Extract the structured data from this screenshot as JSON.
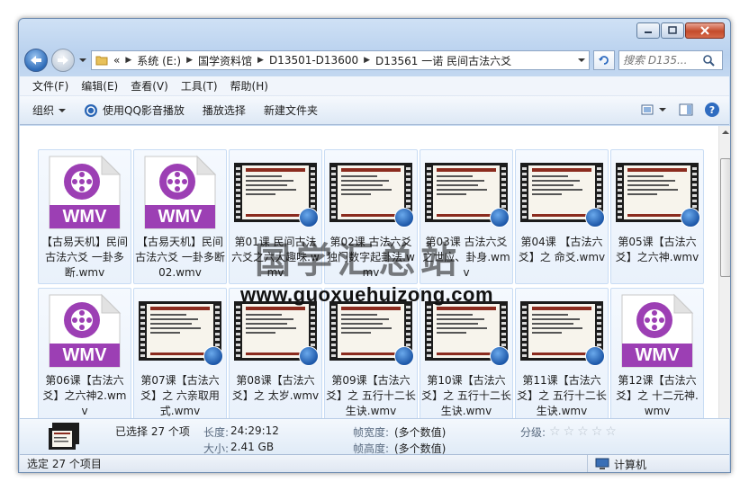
{
  "address_bar": {
    "overflow": "«",
    "crumbs": [
      "系统 (E:)",
      "国学资料馆",
      "D13501-D13600",
      "D13561 一诺 民间古法六爻"
    ]
  },
  "search": {
    "placeholder": "搜索 D135..."
  },
  "menu": [
    "文件(F)",
    "编辑(E)",
    "查看(V)",
    "工具(T)",
    "帮助(H)"
  ],
  "toolbar": {
    "organize": "组织",
    "play_qq": "使用QQ影音播放",
    "play_selection": "播放选择",
    "new_folder": "新建文件夹"
  },
  "files": [
    {
      "name": "【古易天机】民间古法六爻 一卦多断.wmv",
      "kind": "wmv"
    },
    {
      "name": "【古易天机】民间古法六爻 一卦多断02.wmv",
      "kind": "wmv"
    },
    {
      "name": "第01课 民间古法六爻之六大趣味.wmv",
      "kind": "video"
    },
    {
      "name": "第02课 古法六爻独门数字起卦法.wmv",
      "kind": "video"
    },
    {
      "name": "第03课 古法六爻之世应、卦身.wmv",
      "kind": "video"
    },
    {
      "name": "第04课 【古法六爻】之 命爻.wmv",
      "kind": "video"
    },
    {
      "name": "第05课【古法六爻】之六神.wmv",
      "kind": "video"
    },
    {
      "name": "第06课【古法六爻】之六神2.wmv",
      "kind": "wmv"
    },
    {
      "name": "第07课【古法六爻】之 六亲取用式.wmv",
      "kind": "video"
    },
    {
      "name": "第08课【古法六爻】之 太岁.wmv",
      "kind": "video"
    },
    {
      "name": "第09课【古法六爻】之 五行十二长生诀.wmv",
      "kind": "video"
    },
    {
      "name": "第10课【古法六爻】之 五行十二长生诀.wmv",
      "kind": "video"
    },
    {
      "name": "第11课【古法六爻】之 五行十二长生诀.wmv",
      "kind": "video"
    },
    {
      "name": "第12课【古法六爻】之 十二元神.wmv",
      "kind": "wmv"
    }
  ],
  "wmv_label": "WMV",
  "watermark": {
    "cn": "国学汇总站",
    "url": "www.guoxuehuizong.com"
  },
  "details": {
    "selected": "已选择 27 个项",
    "length_label": "长度:",
    "length_value": "24:29:12",
    "size_label": "大小:",
    "size_value": "2.41 GB",
    "frame_width_label": "帧宽度:",
    "frame_width_value": "(多个数值)",
    "frame_height_label": "帧高度:",
    "frame_height_value": "(多个数值)",
    "rating_label": "分级:",
    "rating_stars": 0
  },
  "status": {
    "left": "选定 27 个项目",
    "right": "计算机"
  },
  "colors": {
    "wmv_purple": "#9c3fb4",
    "accent_blue": "#2d6bb8"
  }
}
